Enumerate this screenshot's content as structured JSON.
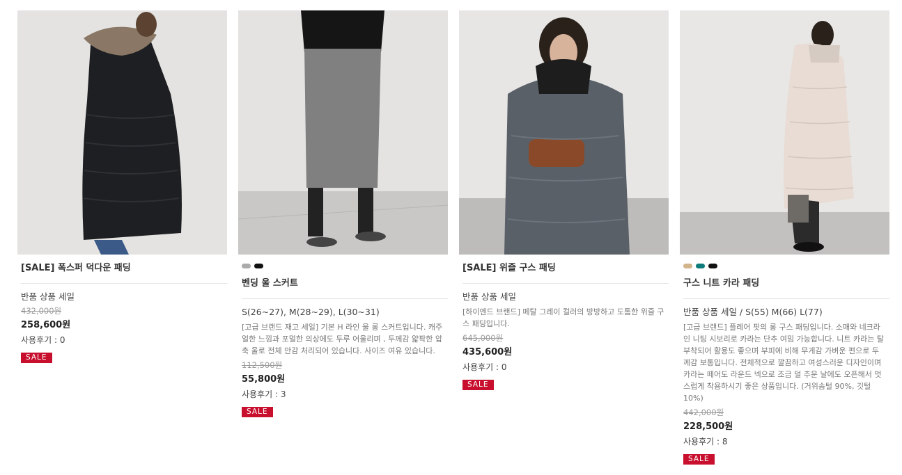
{
  "products": [
    {
      "name": "[SALE] 폭스퍼 덕다운 패딩",
      "summary": "반품 상품 세일",
      "description": "",
      "original_price": "432,000원",
      "price": "258,600원",
      "reviews": "사용후기 : 0",
      "badge": "SALE",
      "swatches": []
    },
    {
      "name": "벤딩 울 스커트",
      "summary": "S(26~27), M(28~29), L(30~31)",
      "description": "[고급 브랜드 재고 세일] 기본 H 라인 울 롱 스커트입니다. 캐주얼한 느낌과 포멀한 의상에도 두루 어울리며 , 두께감 얇팍한 압축 울로 전체 안감 처리되어 있습니다. 사이즈 여유 있습니다.",
      "original_price": "112,500원",
      "price": "55,800원",
      "reviews": "사용후기 : 3",
      "badge": "SALE",
      "swatches": [
        "#aaaaaa",
        "#111111"
      ]
    },
    {
      "name": "[SALE] 위즐 구스 패딩",
      "summary": "반품 상품 세일",
      "description": "[하이엔드 브랜드] 메탈 그레이 컬러의 방방하고 도톰한 위즐 구스 패딩입니다.",
      "original_price": "645,000원",
      "price": "435,600원",
      "reviews": "사용후기 : 0",
      "badge": "SALE",
      "swatches": []
    },
    {
      "name": "구스 니트 카라 패딩",
      "summary": "반품 상품 세일 / S(55) M(66) L(77)",
      "description": "[고급 브랜드] 플레어 핏의 롱 구스 패딩입니다. 소매와 네크라인 니팅 시보리로 카라는 단추 여밈 가능합니다. 니트 카라는 탈부착되어 활용도 좋으며 부피에 비해 무게감 가벼운 편으로 두께감 보통입니다. 전체적으로 깔끔하고 여성스러운 디자인이며 카라는 떼어도 라운드 넥으로 조금 덜 추운 날에도 오픈해서 멋스럽게 착용하시기 좋은 상품입니다. (거위솜털 90%, 깃털 10%)",
      "original_price": "442,000원",
      "price": "228,500원",
      "reviews": "사용후기 : 8",
      "badge": "SALE",
      "swatches": [
        "#d2b48c",
        "#0e7c7b",
        "#111111"
      ]
    }
  ]
}
